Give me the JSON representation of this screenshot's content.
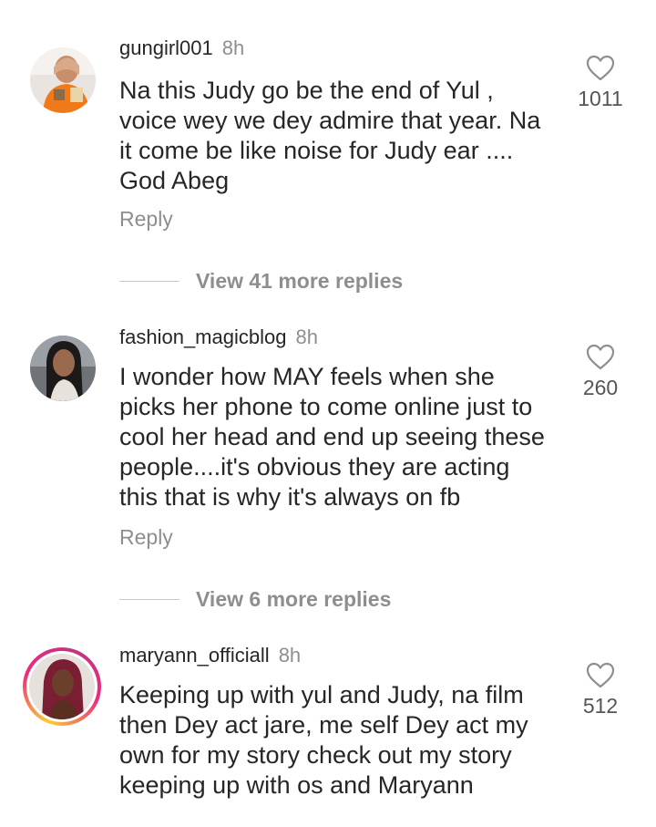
{
  "comments": [
    {
      "username": "gungirl001",
      "time": "8h",
      "text": "Na this Judy go be the end of Yul , voice wey we dey admire that year. Na it come be like noise for Judy ear .... God Abeg",
      "likes": "1011",
      "reply_label": "Reply",
      "view_more": "View 41 more replies",
      "avatar_icon": "profile-photo"
    },
    {
      "username": "fashion_magicblog",
      "time": "8h",
      "text": "I wonder how MAY feels when she picks  her phone to come online just to cool her head and end up seeing these people....it's obvious they are acting this that is why it's always on fb",
      "likes": "260",
      "reply_label": "Reply",
      "view_more": "View 6 more replies",
      "avatar_icon": "profile-photo"
    },
    {
      "username": "maryann_officiall",
      "time": "8h",
      "text": "Keeping up with yul and Judy, na film then Dey act jare, me self Dey act my own for my story check out my story keeping up with os and Maryann",
      "likes": "512",
      "avatar_icon": "profile-photo-story-ring"
    }
  ],
  "colors": {
    "text": "#262626",
    "muted": "#8e8e8e",
    "story_ring": "#ee2a7b"
  }
}
